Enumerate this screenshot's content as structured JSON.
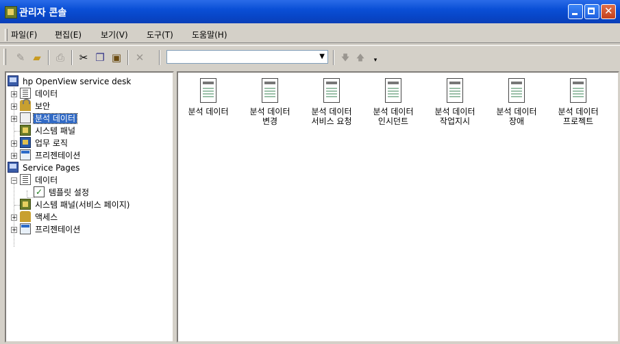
{
  "window": {
    "title": "관리자 콘솔"
  },
  "menu": [
    {
      "label": "파일(F)"
    },
    {
      "label": "편집(E)"
    },
    {
      "label": "보기(V)"
    },
    {
      "label": "도구(T)"
    },
    {
      "label": "도움말(H)"
    }
  ],
  "toolbar": {
    "buttons": [
      "new-icon",
      "open-folder-icon",
      "print-icon",
      "cut-icon",
      "copy-icon",
      "paste-icon",
      "delete-icon",
      "move-down-icon",
      "move-up-icon"
    ],
    "combo_value": ""
  },
  "tree": {
    "root1": "hp OpenView service desk",
    "items1": [
      "데이터",
      "보안",
      "분석 데이터",
      "시스템 패널",
      "업무 로직",
      "프리젠테이션"
    ],
    "root2": "Service Pages",
    "items2": [
      "데이터",
      "템플릿 설정",
      "시스템 패널(서비스 페이지)",
      "액세스",
      "프리젠테이션"
    ],
    "selected": "분석 데이터"
  },
  "list": {
    "items": [
      {
        "line1": "분석 데이터",
        "line2": ""
      },
      {
        "line1": "분석 데이터",
        "line2": "변경"
      },
      {
        "line1": "분석 데이터",
        "line2": "서비스 요청"
      },
      {
        "line1": "분석 데이터",
        "line2": "인시던트"
      },
      {
        "line1": "분석 데이터",
        "line2": "작업지시"
      },
      {
        "line1": "분석 데이터",
        "line2": "장애"
      },
      {
        "line1": "분석 데이터",
        "line2": "프로젝트"
      }
    ]
  },
  "colors": {
    "titlebar": "#0a4fd6",
    "selection": "#316ac5",
    "chrome": "#d4d0c8"
  }
}
